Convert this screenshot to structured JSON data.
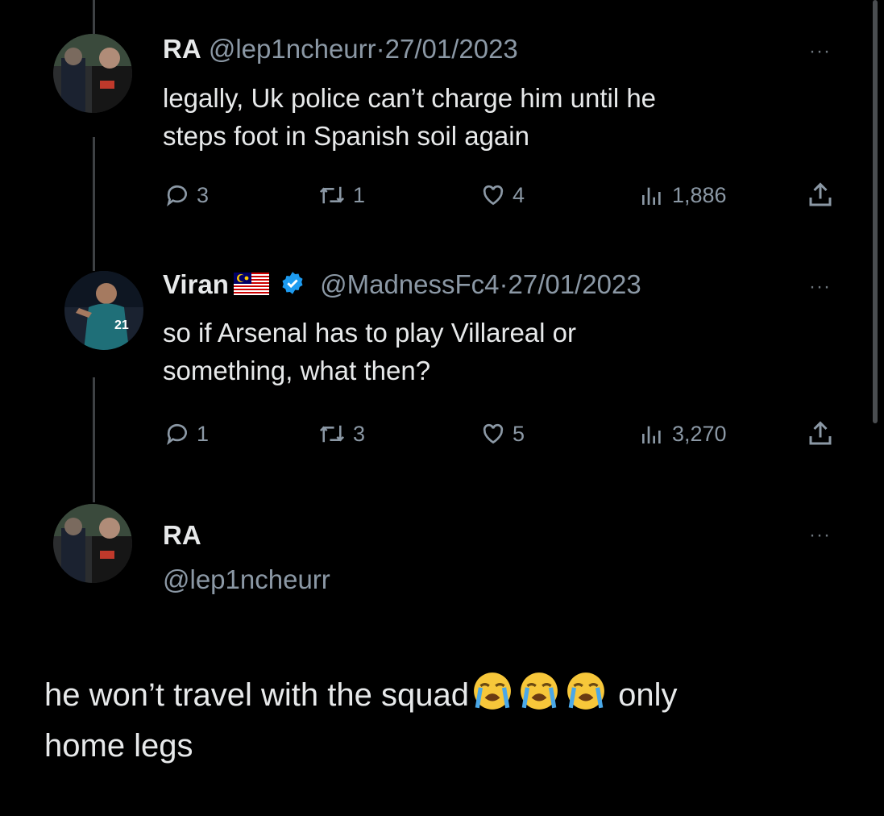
{
  "tweets": [
    {
      "name": "RA",
      "handle": "@lep1ncheurr",
      "sep": "·",
      "date": "27/01/2023",
      "text_line1": "legally, Uk police can’t charge him until he",
      "text_line2": "steps foot in Spanish soil again",
      "replies": "3",
      "retweets": "1",
      "likes": "4",
      "views": "1,886"
    },
    {
      "name": "Viran",
      "handle": "@MadnessFc4",
      "sep": "·",
      "date": "27/01/2023",
      "flag": "malaysia-flag-emoji",
      "verified": true,
      "text_line1": "so if Arsenal has to play Villareal or",
      "text_line2": "something, what then?",
      "replies": "1",
      "retweets": "3",
      "likes": "5",
      "views": "3,270"
    }
  ],
  "main_tweet": {
    "name": "RA",
    "handle": "@lep1ncheurr",
    "text_part1": "he won’t travel with the squad",
    "emoji": "loudly-crying-face",
    "emoji_count": 3,
    "text_part2": " only",
    "text_line2": "home legs"
  },
  "more_label": "···",
  "icons": [
    "reply-icon",
    "retweet-icon",
    "like-icon",
    "views-icon",
    "share-icon",
    "verified-badge-icon",
    "more-icon"
  ],
  "colors": {
    "background": "#000000",
    "text": "#e7e9ea",
    "muted": "#8b98a5",
    "verified": "#1d9bf0",
    "thread_line": "#3e4144"
  }
}
